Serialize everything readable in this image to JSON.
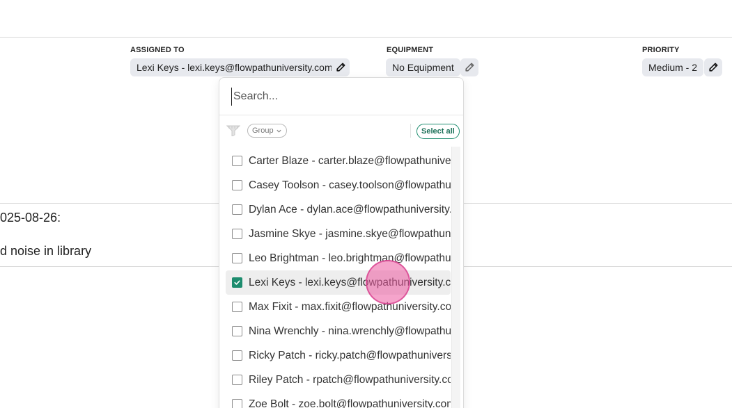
{
  "fields": {
    "assigned_to": {
      "label": "ASSIGNED TO",
      "value": "Lexi Keys - lexi.keys@flowpathuniversity.com"
    },
    "equipment": {
      "label": "EQUIPMENT",
      "value": "No Equipment"
    },
    "priority": {
      "label": "PRIORITY",
      "value": "Medium - 2"
    }
  },
  "background": {
    "date_text": "025-08-26:",
    "note_text": "d noise in library"
  },
  "dropdown": {
    "search_placeholder": "Search...",
    "group_label": "Group",
    "select_all_label": "Select all",
    "items": [
      {
        "label": "Carter Blaze - carter.blaze@flowpathuniversity.com",
        "checked": false
      },
      {
        "label": "Casey Toolson - casey.toolson@flowpathuniversity.com",
        "checked": false
      },
      {
        "label": "Dylan Ace - dylan.ace@flowpathuniversity.com",
        "checked": false
      },
      {
        "label": "Jasmine Skye - jasmine.skye@flowpathuniversity.com",
        "checked": false
      },
      {
        "label": "Leo Brightman - leo.brightman@flowpathuniversity.com",
        "checked": false
      },
      {
        "label": "Lexi Keys - lexi.keys@flowpathuniversity.com",
        "checked": true
      },
      {
        "label": "Max Fixit - max.fixit@flowpathuniversity.com",
        "checked": false
      },
      {
        "label": "Nina Wrenchly - nina.wrenchly@flowpathuniversity.com",
        "checked": false
      },
      {
        "label": "Ricky Patch - ricky.patch@flowpathuniversity.com",
        "checked": false
      },
      {
        "label": "Riley Patch - rpatch@flowpathuniversity.com",
        "checked": false
      },
      {
        "label": "Zoe Bolt - zoe.bolt@flowpathuniversity.com",
        "checked": false
      }
    ]
  },
  "colors": {
    "accent": "#1d8c6e",
    "chip_bg": "#e7e9ee"
  },
  "icons": {
    "edit": "pencil-icon",
    "filter": "filter-icon",
    "chevron": "chevron-down-icon",
    "check": "check-icon"
  }
}
